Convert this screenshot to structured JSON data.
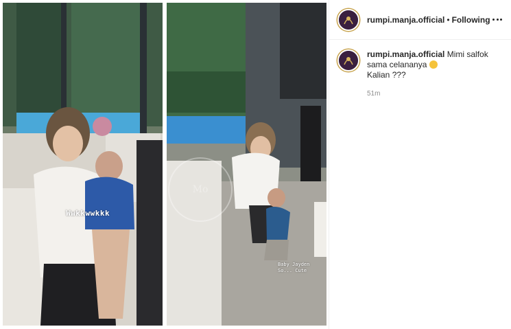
{
  "header": {
    "username": "rumpi.manja.official",
    "separator": "•",
    "follow_status": "Following"
  },
  "caption": {
    "username": "rumpi.manja.official",
    "text_line1": "Mimi salfok",
    "text_line2": "sama celananya",
    "text_line3": "Kalian ???",
    "timestamp": "51m"
  },
  "media": {
    "left_overlay": "Wwkkwwkkk",
    "right_overlay_line1": "Baby Jayden",
    "right_overlay_line2": "So... Cute"
  },
  "icons": {
    "more_options": "more-horizontal-icon",
    "emoji": "laughing-emoji-icon"
  },
  "colors": {
    "text": "#262626",
    "secondary": "#8e8e8e",
    "avatar_bg": "#3a1f3f",
    "avatar_ring": "#c7a34e"
  }
}
